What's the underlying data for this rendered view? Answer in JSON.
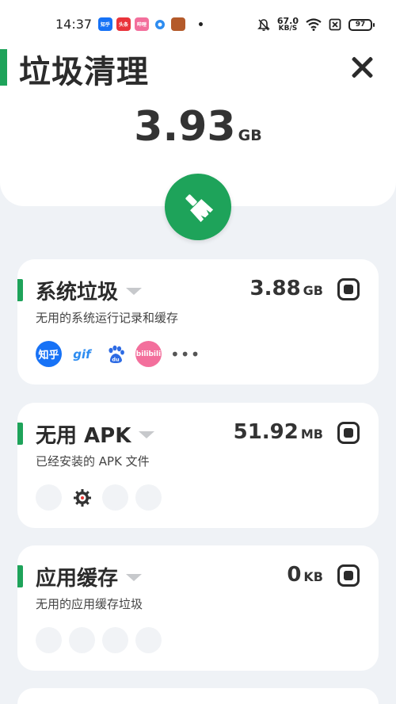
{
  "status_bar": {
    "time": "14:37",
    "apps": [
      {
        "name": "zhihu",
        "label": "知乎",
        "color": "#1772f6"
      },
      {
        "name": "toutiao",
        "label": "头条",
        "color": "#e9333b"
      },
      {
        "name": "bilibili",
        "label": "哔哩",
        "color": "#f36f9c"
      },
      {
        "name": "qq-browser",
        "label": "",
        "color": "#2d8cf0"
      },
      {
        "name": "game",
        "label": "",
        "color": "#b45a2a"
      }
    ],
    "speed_value": "67.0",
    "speed_unit": "KB/S",
    "battery": "97"
  },
  "header": {
    "title": "垃圾清理",
    "total_size": "3.93",
    "total_unit": "GB"
  },
  "colors": {
    "accent": "#1ea35a",
    "text": "#2b2b2b"
  },
  "cards": [
    {
      "title": "系统垃圾",
      "subtitle": "无用的系统运行记录和缓存",
      "size": "3.88",
      "unit": "GB",
      "icons": [
        "知乎",
        "gif",
        "du",
        "bilibili"
      ],
      "more": "•••"
    },
    {
      "title": "无用 APK",
      "subtitle": "已经安装的 APK 文件",
      "size": "51.92",
      "unit": "MB"
    },
    {
      "title": "应用缓存",
      "subtitle": "无用的应用缓存垃圾",
      "size": "0",
      "unit": "KB"
    }
  ]
}
